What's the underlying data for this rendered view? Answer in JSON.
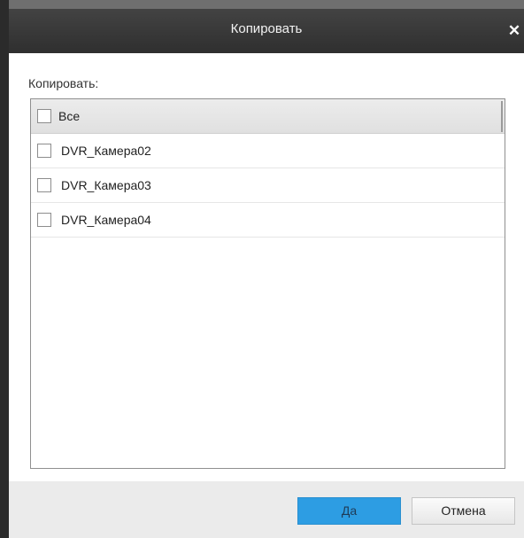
{
  "dialog": {
    "title": "Копировать",
    "close_glyph": "✕"
  },
  "body": {
    "section_label": "Копировать:",
    "list": {
      "header_label": "Все",
      "items": [
        {
          "label": "DVR_Камера02",
          "checked": false
        },
        {
          "label": "DVR_Камера03",
          "checked": false
        },
        {
          "label": "DVR_Камера04",
          "checked": false
        }
      ]
    }
  },
  "footer": {
    "ok_label": "Да",
    "cancel_label": "Отмена"
  },
  "colors": {
    "titlebar": "#2f2f2f",
    "primary_button": "#2d9de3",
    "window_bg": "#f0f0f0"
  },
  "icons": {
    "close": "close-icon",
    "checkbox": "checkbox-icon"
  }
}
